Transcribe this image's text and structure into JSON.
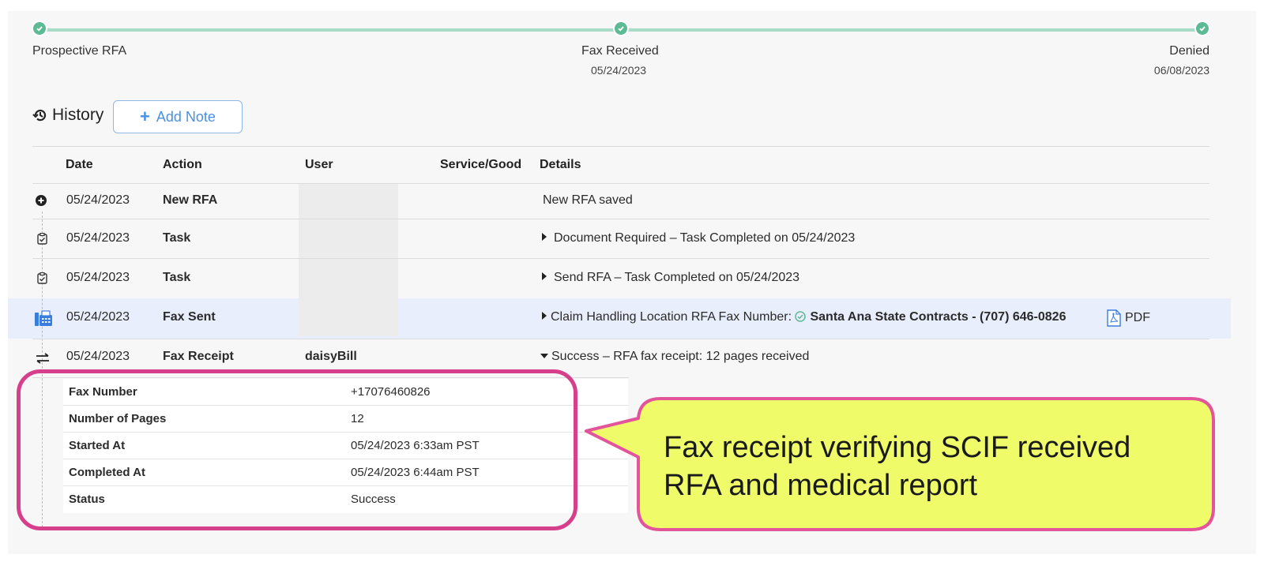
{
  "progress": {
    "steps": [
      {
        "label": "Prospective RFA",
        "date": ""
      },
      {
        "label": "Fax Received",
        "date": "05/24/2023"
      },
      {
        "label": "Denied",
        "date": "06/08/2023"
      }
    ]
  },
  "history": {
    "title": "History",
    "add_note_label": "Add Note"
  },
  "table": {
    "headers": {
      "date": "Date",
      "action": "Action",
      "user": "User",
      "service": "Service/Good",
      "details": "Details"
    },
    "rows": [
      {
        "icon": "plus-circle-icon",
        "date": "05/24/2023",
        "action": "New RFA",
        "user": "",
        "details": "New RFA saved"
      },
      {
        "icon": "clipboard-check-icon",
        "date": "05/24/2023",
        "action": "Task",
        "user": "",
        "details": "Document Required – Task Completed on 05/24/2023"
      },
      {
        "icon": "clipboard-check-icon",
        "date": "05/24/2023",
        "action": "Task",
        "user": "",
        "details": "Send RFA – Task Completed on 05/24/2023"
      },
      {
        "icon": "fax-icon",
        "date": "05/24/2023",
        "action": "Fax Sent",
        "user": "",
        "details_prefix": "Claim Handling Location RFA Fax Number:",
        "details_strong": "Santa Ana State Contracts - (707) 646-0826",
        "attachment": "PDF"
      },
      {
        "icon": "swap-arrows-icon",
        "date": "05/24/2023",
        "action": "Fax Receipt",
        "user": "daisyBill",
        "details": "Success – RFA fax receipt: 12 pages received"
      }
    ]
  },
  "fax_receipt": {
    "rows": [
      {
        "label": "Fax Number",
        "value": "+17076460826"
      },
      {
        "label": "Number of Pages",
        "value": "12"
      },
      {
        "label": "Started At",
        "value": "05/24/2023 6:33am PST"
      },
      {
        "label": "Completed At",
        "value": "05/24/2023 6:44am PST"
      },
      {
        "label": "Status",
        "value": "Success"
      }
    ]
  },
  "callout": {
    "line1": "Fax receipt verifying SCIF received",
    "line2": "RFA and medical report"
  },
  "colors": {
    "accent": "#4a90e2",
    "progress_green": "#5dba94",
    "highlight_row": "#e8eefb",
    "annotation_pink": "#d63f8c",
    "callout_fill": "#f0fb6a"
  }
}
